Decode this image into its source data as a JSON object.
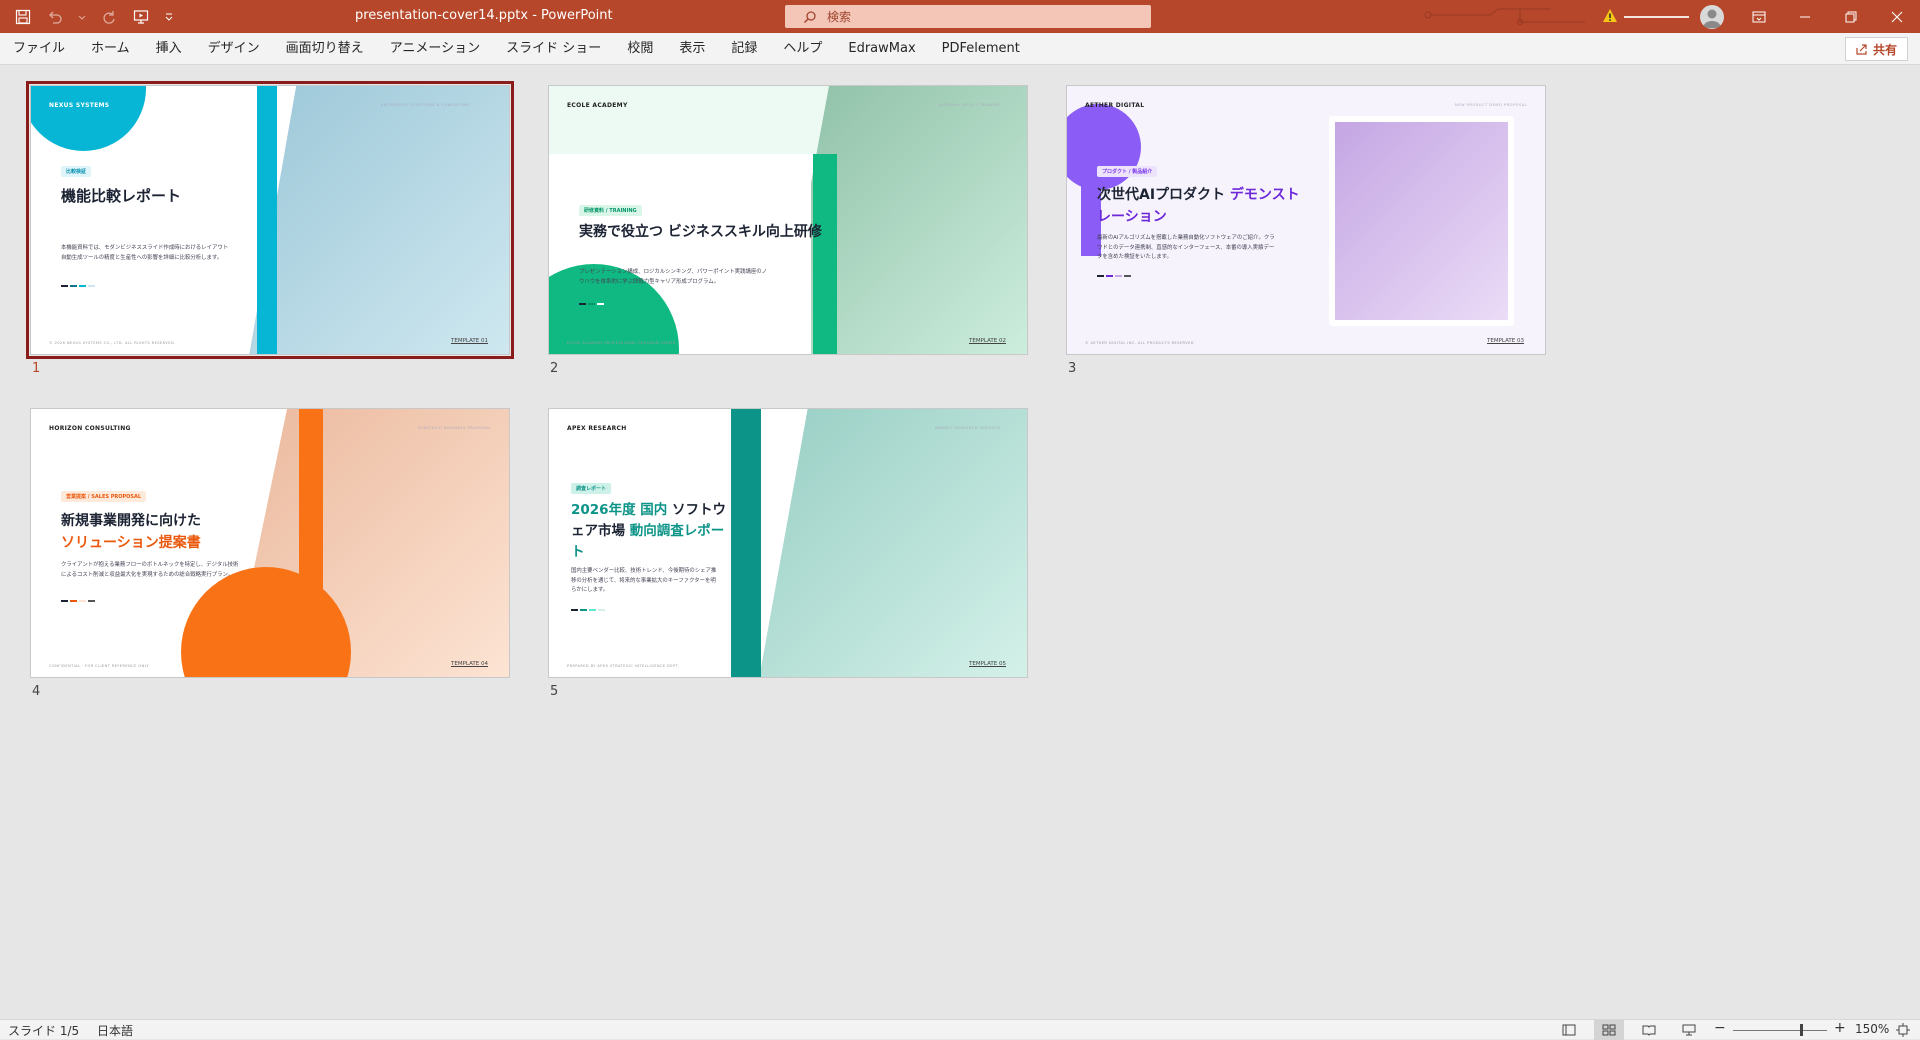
{
  "titlebar": {
    "document_title": "presentation-cover14.pptx  -  PowerPoint",
    "search_placeholder": "検索",
    "qat_icons": [
      "save-icon",
      "undo-icon",
      "redo-icon",
      "start-from-beginning-icon",
      "customize-qat-icon"
    ],
    "window_buttons": [
      "ribbon-display-options-icon",
      "minimize-icon",
      "restore-icon",
      "close-icon"
    ]
  },
  "ribbon": {
    "tabs": [
      "ファイル",
      "ホーム",
      "挿入",
      "デザイン",
      "画面切り替え",
      "アニメーション",
      "スライド ショー",
      "校閲",
      "表示",
      "記録",
      "ヘルプ",
      "EdrawMax",
      "PDFelement"
    ],
    "share_label": "共有"
  },
  "slides": [
    {
      "number": "1",
      "selected": true,
      "logo": "NEXUS SYSTEMS",
      "tagline": "ENTERPRISE SOLUTIONS & CONSULTING",
      "badge": "比較検証",
      "headline": "機能比較レポート",
      "body": "本機能資料では、モダンビジネススライド作成時におけるレイアウト自動生成ツールの精度と生産性への影響を詳細に比較分析します。",
      "footer_left": "© 2026 NEXUS SYSTEMS CO., LTD. ALL RIGHTS RESERVED.",
      "footer_right": "TEMPLATE 01",
      "accent": "#06b6d4"
    },
    {
      "number": "2",
      "selected": false,
      "logo": "ECOLE ACADEMY",
      "tagline": "INTERNAL DECK / TRAINING",
      "badge": "研修資料 / TRAINING",
      "headline": "実務で役立つ ビジネススキル向上研修",
      "body": "プレゼンテーション構成、ロジカルシンキング、パワーポイント実践講座のノウハウを体系的に学ぶ即戦力型キャリア形成プログラム。",
      "footer_left": "ECOLE ACADEMY PROFESSIONAL PROGRAM SERIES",
      "footer_right": "TEMPLATE 02",
      "accent": "#10b981"
    },
    {
      "number": "3",
      "selected": false,
      "logo": "AETHER DIGITAL",
      "tagline": "NEW PRODUCT DEMO PROPOSAL",
      "badge": "プロダクト / 製品紹介",
      "headline_a": "次世代AIプロダクト ",
      "headline_b": "デモンストレーション",
      "body": "最新のAIアルゴリズムを搭載した業務自動化ソフトウェアのご紹介。クラウドとのデータ連携制、直感的なインターフェース、本番の導入実績データを含めた検証をいたします。",
      "footer_left": "© AETHER DIGITAL INC. ALL PRODUCTS RESERVED",
      "footer_right": "TEMPLATE 03",
      "accent": "#8b5cf6"
    },
    {
      "number": "4",
      "selected": false,
      "logo": "HORIZON CONSULTING",
      "tagline": "STRATEGIC BUSINESS PROPOSAL",
      "badge": "営業提案 / SALES PROPOSAL",
      "headline_a": "新規事業開発に向けた",
      "headline_b": "ソリューション提案書",
      "body": "クライアントが抱える業務フローのボトルネックを特定し、デジタル技術によるコスト削減と収益最大化を実現するための総合戦略実行プラン。",
      "footer_left": "CONFIDENTIAL · FOR CLIENT REFERENCE ONLY",
      "footer_right": "TEMPLATE 04",
      "accent": "#f97316"
    },
    {
      "number": "5",
      "selected": false,
      "logo": "APEX RESEARCH",
      "tagline": "MARKET RESEARCH INSIGHTS",
      "badge": "調査レポート",
      "headline_a": "2026年度 国内",
      "headline_b": " ソフトウェア市場 ",
      "headline_c": "動向調査レポート",
      "body": "国内主要ベンダー比較、技術トレンド、今後期待のシェア推移の分析を通じて、将来的な事業拡大のキーファクターを明らかにします。",
      "footer_left": "PREPARED BY APEX STRATEGIC INTELLIGENCE DEPT.",
      "footer_right": "TEMPLATE 05",
      "accent": "#0d9488"
    }
  ],
  "statusbar": {
    "slide_indicator": "スライド 1/5",
    "language": "日本語",
    "zoom_minus": "−",
    "zoom_plus": "+",
    "zoom_level": "150%"
  }
}
